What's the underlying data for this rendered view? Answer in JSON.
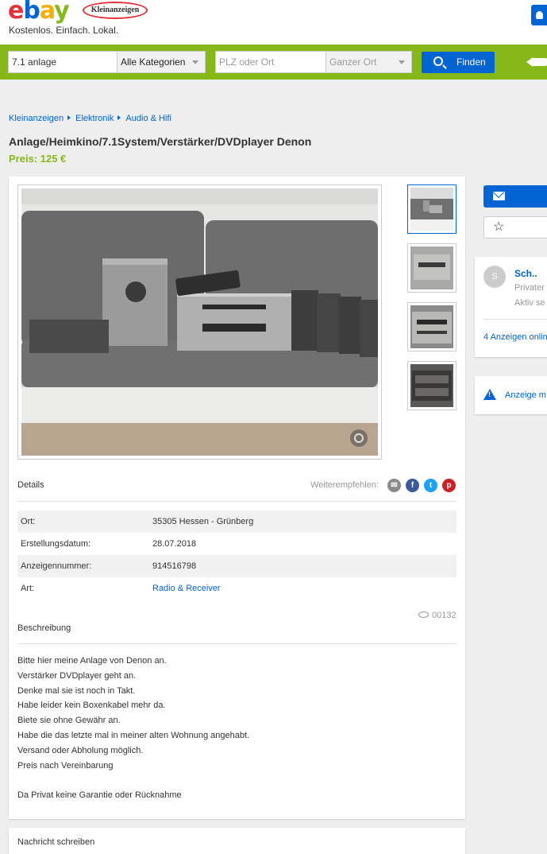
{
  "header": {
    "logo_parts": [
      "e",
      "b",
      "a",
      "y"
    ],
    "badge": "Kleinanzeigen",
    "tagline": "Kostenlos. Einfach. Lokal."
  },
  "search": {
    "query": "7.1 anlage",
    "category": "Alle Kategorien",
    "location_placeholder": "PLZ oder Ort",
    "radius": "Ganzer Ort",
    "button": "Finden"
  },
  "breadcrumb": [
    "Kleinanzeigen",
    "Elektronik",
    "Audio & Hifi"
  ],
  "listing": {
    "title": "Anlage/Heimkino/7.1System/Verstärker/DVDplayer Denon",
    "price": "Preis: 125 €"
  },
  "details": {
    "heading": "Details",
    "share_label": "Weiterempfehlen:",
    "rows": [
      {
        "key": "Ort:",
        "value": "35305 Hessen - Grünberg"
      },
      {
        "key": "Erstellungsdatum:",
        "value": "28.07.2018"
      },
      {
        "key": "Anzeigennummer:",
        "value": "914516798"
      },
      {
        "key": "Art:",
        "value": "Radio & Receiver"
      }
    ]
  },
  "description": {
    "heading": "Beschreibung",
    "views": "00132",
    "lines": [
      "Bitte hier meine Anlage von Denon an.",
      "Verstärker DVDplayer geht an.",
      "Denke mal sie ist noch in Takt.",
      "Habe leider kein Boxenkabel mehr da.",
      "Biete sie ohne Gewähr an.",
      "Habe die das letzte mal in meiner alten Wohnung angehabt.",
      "Versand oder Abholung möglich.",
      "Preis nach Vereinbarung",
      "",
      "Da Privat keine Garantie oder Rücknahme"
    ]
  },
  "message": {
    "heading": "Nachricht schreiben"
  },
  "seller": {
    "initial": "S",
    "name": "Sch..",
    "type": "Privater",
    "active": "Aktiv se",
    "ads_link": "4 Anzeigen onlin"
  },
  "report": {
    "label": "Anzeige m"
  },
  "colors": {
    "brand_green": "#86b817",
    "brand_blue": "#0064d2",
    "ebay_red": "#e53238",
    "ebay_yellow": "#f5af02"
  }
}
